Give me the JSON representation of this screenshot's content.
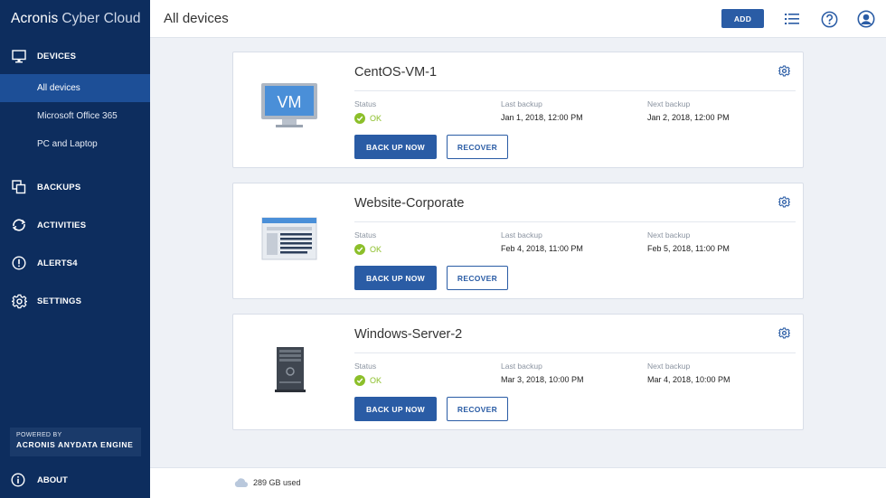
{
  "brand": {
    "name_bold": "Acronis",
    "name_rest": "Cyber Cloud"
  },
  "sidebar": {
    "devices": {
      "label": "DEVICES",
      "icon": "monitor-icon"
    },
    "sub_items": [
      {
        "label": "All devices",
        "active": true
      },
      {
        "label": "Microsoft Office 365",
        "active": false
      },
      {
        "label": "PC and Laptop",
        "active": false
      }
    ],
    "items": [
      {
        "label": "BACKUPS",
        "icon": "backups-icon"
      },
      {
        "label": "ACTIVITIES",
        "icon": "activities-icon"
      },
      {
        "label": "ALERTS4",
        "icon": "alert-icon"
      },
      {
        "label": "SETTINGS",
        "icon": "gear-icon"
      }
    ],
    "powered_by": "POWERED BY",
    "engine": "ACRONIS ANYDATA ENGINE",
    "about": "ABOUT"
  },
  "header": {
    "title": "All devices",
    "add_label": "ADD"
  },
  "cards": [
    {
      "name": "CentOS-VM-1",
      "thumb": "vm-icon",
      "thumb_text": "VM",
      "status_label": "Status",
      "status": "OK",
      "last_label": "Last backup",
      "last": "Jan 1, 2018, 12:00 PM",
      "next_label": "Next backup",
      "next": "Jan 2, 2018, 12:00 PM",
      "backup_label": "BACK UP NOW",
      "recover_label": "RECOVER"
    },
    {
      "name": "Website-Corporate",
      "thumb": "website-icon",
      "status_label": "Status",
      "status": "OK",
      "last_label": "Last backup",
      "last": "Feb 4, 2018, 11:00 PM",
      "next_label": "Next backup",
      "next": "Feb 5, 2018, 11:00 PM",
      "backup_label": "BACK UP NOW",
      "recover_label": "RECOVER"
    },
    {
      "name": "Windows-Server-2",
      "thumb": "server-icon",
      "status_label": "Status",
      "status": "OK",
      "last_label": "Last backup",
      "last": "Mar 3, 2018, 10:00 PM",
      "next_label": "Next backup",
      "next": "Mar 4, 2018, 10:00 PM",
      "backup_label": "BACK UP NOW",
      "recover_label": "RECOVER"
    }
  ],
  "footer": {
    "storage": "289 GB used"
  },
  "colors": {
    "sidebar": "#0d2d5e",
    "active": "#1d4f97",
    "primary": "#2a5ca5",
    "ok": "#8cbf2a"
  }
}
